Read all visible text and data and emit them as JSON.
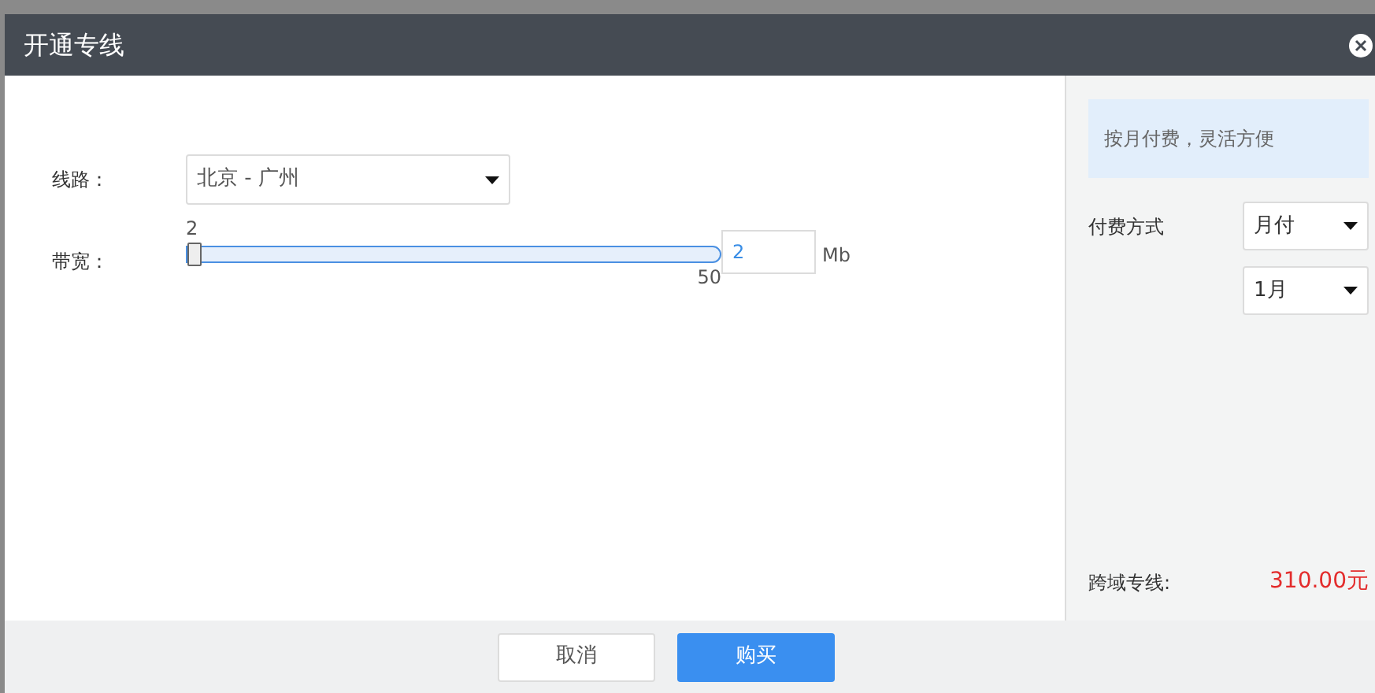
{
  "dialog": {
    "title": "开通专线"
  },
  "form": {
    "route": {
      "label": "线路：",
      "value": "北京 - 广州"
    },
    "bandwidth": {
      "label": "带宽：",
      "min": "2",
      "max": "50",
      "level": 0,
      "value": "2",
      "unit": "Mb"
    }
  },
  "side": {
    "notice": "按月付费，灵活方便",
    "payment_label": "付费方式",
    "payment_value": "月付",
    "period_value": "1月",
    "total_label": "跨域专线:",
    "total": "310.00元"
  },
  "buttons": [
    {
      "label": "取消",
      "kind": "secondary"
    },
    {
      "label": "购买",
      "kind": "primary"
    }
  ]
}
